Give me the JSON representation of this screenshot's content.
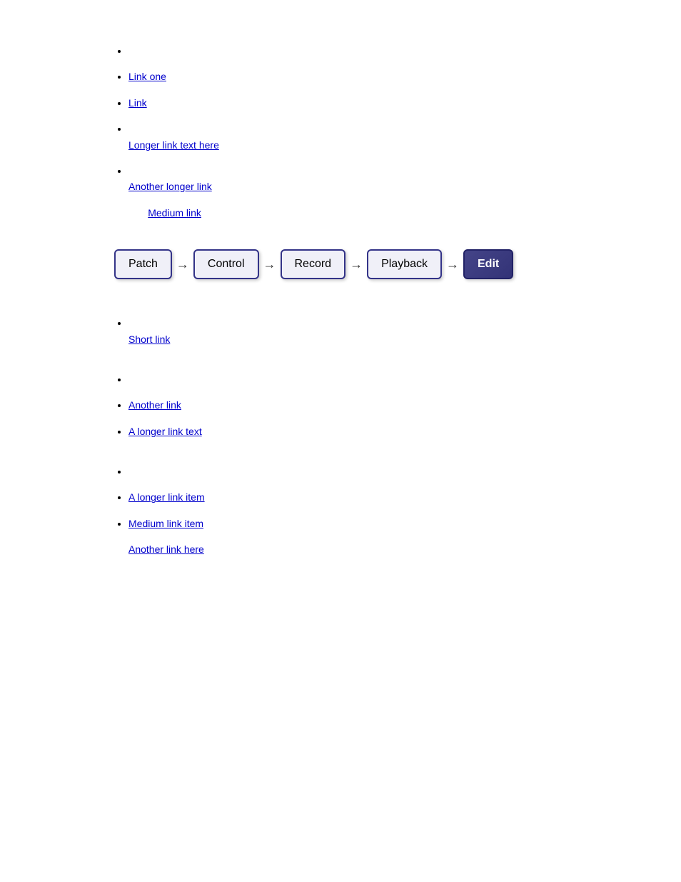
{
  "top_section": {
    "items": [
      {
        "text": "",
        "link": null
      },
      {
        "text": "",
        "link": "Link one"
      },
      {
        "text": "",
        "link": "Link"
      },
      {
        "text": "",
        "link": "Longer link text here"
      },
      {
        "text": "",
        "link": "Another longer link"
      },
      {
        "text": "",
        "link": "Medium link"
      }
    ]
  },
  "workflow": {
    "steps": [
      {
        "label": "Patch",
        "active": false
      },
      {
        "label": "Control",
        "active": false
      },
      {
        "label": "Record",
        "active": false
      },
      {
        "label": "Playback",
        "active": false
      },
      {
        "label": "Edit",
        "active": true
      }
    ],
    "arrow": "→"
  },
  "bottom_section": {
    "groups": [
      {
        "items": [
          {
            "text": "",
            "link": "Short link"
          }
        ]
      },
      {
        "items": [
          {
            "text": "",
            "link": null
          },
          {
            "text": "",
            "link": "Another link"
          },
          {
            "text": "",
            "link": "A longer link text"
          }
        ]
      },
      {
        "items": [
          {
            "text": "",
            "link": null
          },
          {
            "text": "",
            "link": "A longer link item"
          },
          {
            "text": "",
            "link": "Medium link item"
          },
          {
            "text": "",
            "link": "Another link here"
          }
        ]
      }
    ]
  }
}
